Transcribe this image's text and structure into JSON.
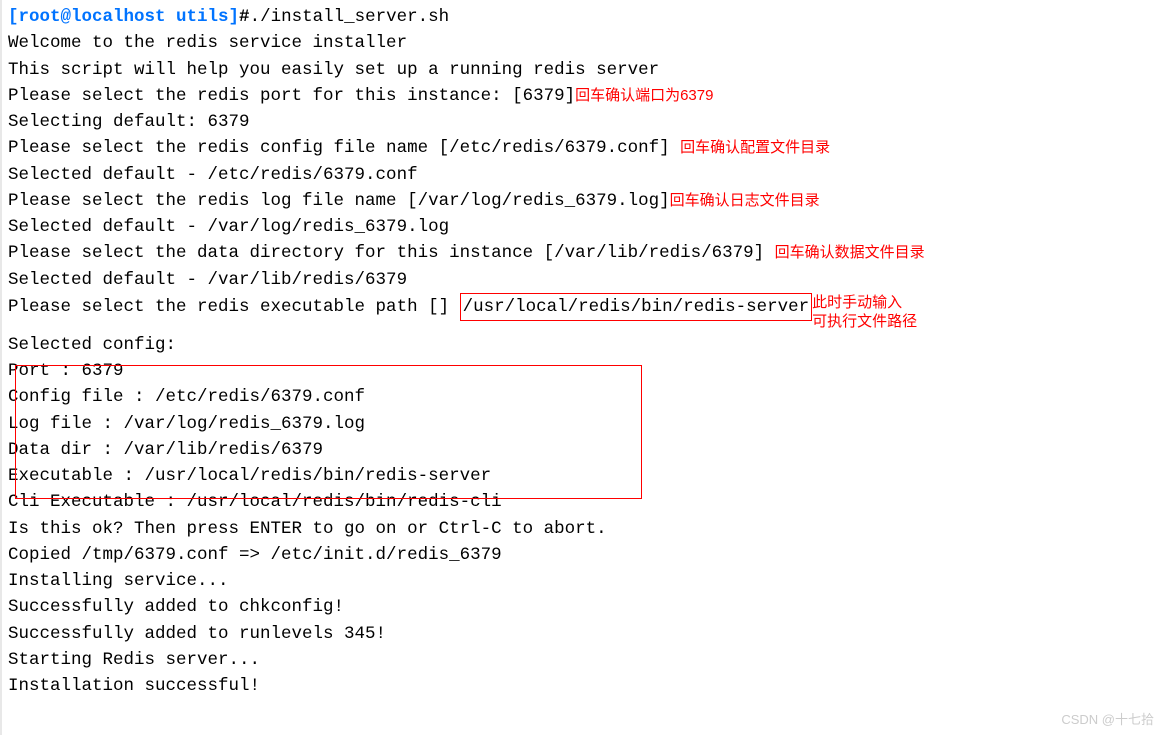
{
  "prompt": "[root@localhost utils]",
  "hash": "#",
  "command": "./install_server.sh",
  "welcome1": "Welcome to the redis service installer",
  "welcome2": "This script will help you easily set up a running redis server",
  "blank": " ",
  "port_prompt": "Please select the redis port for this instance: [6379]",
  "port_annotation": "回车确认端口为6379",
  "port_default": "Selecting default: 6379",
  "config_prompt": "Please select the redis config file name [/etc/redis/6379.conf]",
  "config_annotation": "回车确认配置文件目录",
  "config_default": "Selected default - /etc/redis/6379.conf",
  "log_prompt": "Please select the redis log file name [/var/log/redis_6379.log]",
  "log_annotation": "回车确认日志文件目录",
  "log_default": "Selected default - /var/log/redis_6379.log",
  "data_prompt": "Please select the data directory for this instance [/var/lib/redis/6379]",
  "data_annotation": "回车确认数据文件目录",
  "data_default": "Selected default - /var/lib/redis/6379",
  "exec_prompt": "Please select the redis executable path []",
  "exec_path": "/usr/local/redis/bin/redis-server",
  "exec_annotation1": "此时手动输入",
  "exec_annotation2": "可执行文件路径",
  "selected_config": "Selected config:",
  "summary_port": "Port           : 6379",
  "summary_config": "Config file    : /etc/redis/6379.conf",
  "summary_log": "Log file       : /var/log/redis_6379.log",
  "summary_datadir": "Data dir       : /var/lib/redis/6379",
  "summary_exec": "Executable     : /usr/local/redis/bin/redis-server",
  "summary_cli": "Cli Executable : /usr/local/redis/bin/redis-cli",
  "ok_prompt": "Is this ok? Then press ENTER to go on or Ctrl-C to abort.",
  "copied": "Copied /tmp/6379.conf => /etc/init.d/redis_6379",
  "installing": "Installing service...",
  "success_chk": "Successfully added to chkconfig!",
  "success_run": "Successfully added to runlevels 345!",
  "starting": "Starting Redis server...",
  "install_success": "Installation successful!",
  "watermark": "CSDN @十七拾"
}
